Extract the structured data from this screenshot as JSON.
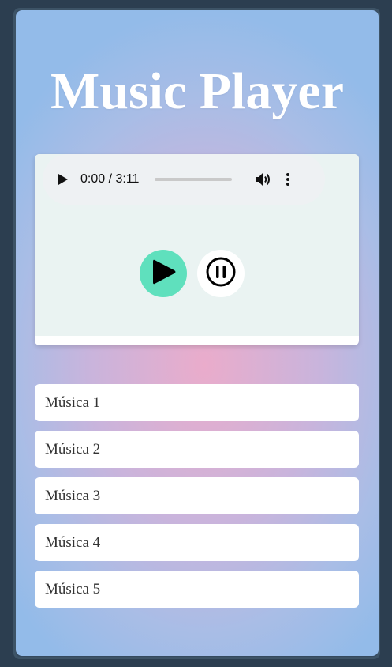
{
  "app": {
    "title": "Music Player"
  },
  "audio": {
    "time_display": "0:00 / 3:11",
    "progress": 0
  },
  "controls": {
    "play_icon": "play-icon",
    "pause_icon": "pause-circle-icon",
    "play_color": "#5fe0bd"
  },
  "playlist": {
    "items": [
      {
        "label": "Música 1"
      },
      {
        "label": "Música 2"
      },
      {
        "label": "Música 3"
      },
      {
        "label": "Música 4"
      },
      {
        "label": "Música 5"
      }
    ]
  }
}
